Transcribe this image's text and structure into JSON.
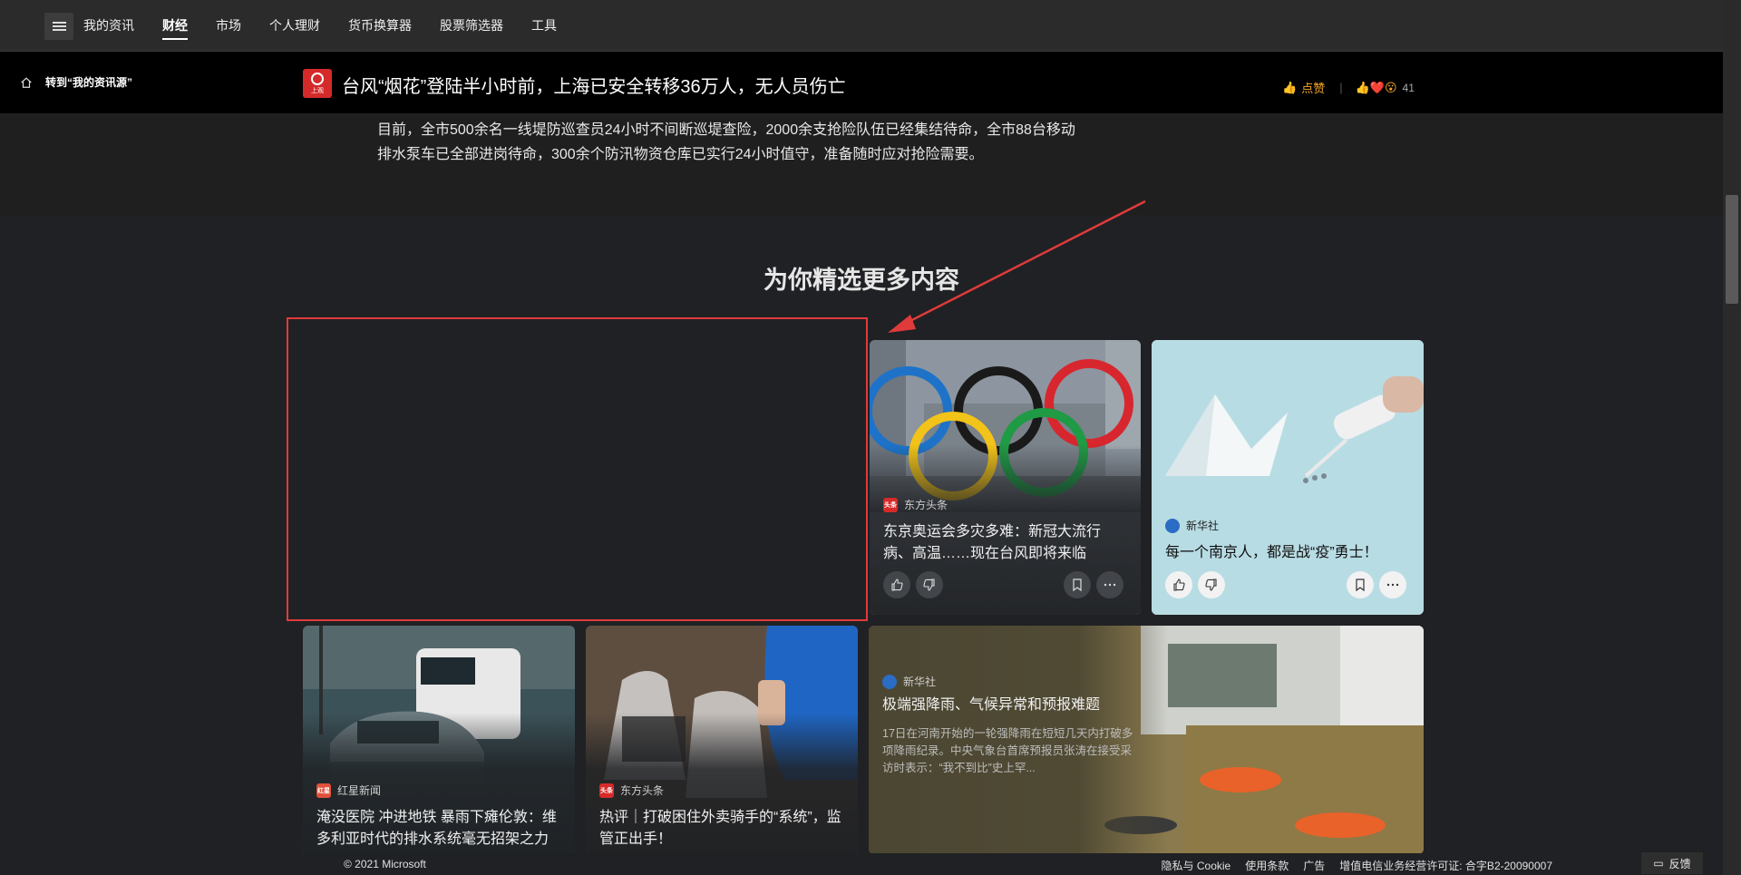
{
  "nav": {
    "items": [
      {
        "label": "我的资讯",
        "active": false
      },
      {
        "label": "财经",
        "active": true
      },
      {
        "label": "市场",
        "active": false
      },
      {
        "label": "个人理财",
        "active": false
      },
      {
        "label": "货币换算器",
        "active": false
      },
      {
        "label": "股票筛选器",
        "active": false
      },
      {
        "label": "工具",
        "active": false
      }
    ]
  },
  "article_header": {
    "back_label": "转到“我的资讯源”",
    "publisher_logo_text": "上观",
    "title": "台风“烟花”登陆半小时前，上海已安全转移36万人，无人员伤亡",
    "like_label": "点赞",
    "reaction_count": "41"
  },
  "article_body": {
    "paragraph": "目前，全市500余名一线堤防巡查员24小时不间断巡堤查险，2000余支抢险队伍已经集结待命，全市88台移动排水泵车已全部进岗待命，300余个防汛物资仓库已实行24小时值守，准备随时应对抢险需要。"
  },
  "section": {
    "title": "为你精选更多内容"
  },
  "cards": [
    {
      "source": "东方头条",
      "source_logo": "头条",
      "title": "东京奥运会多灾多难：新冠大流行病、高温……现在台风即将来临",
      "image": "olympic-rings"
    },
    {
      "source": "新华社",
      "title": "每一个南京人，都是战“疫”勇士！",
      "image": "medical-swab"
    },
    {
      "source": "红星新闻",
      "source_logo": "红星",
      "title": "淹没医院 冲进地铁 暴雨下瘫伦敦：维多利亚时代的排水系统毫无招架之力",
      "image": "flooded-street"
    },
    {
      "source": "东方头条",
      "source_logo": "头条",
      "title": "热评｜打破困住外卖骑手的“系统”，监管正出手！",
      "image": "delivery-bags"
    },
    {
      "source": "新华社",
      "title": "极端强降雨、气候异常和预报难题",
      "desc": "17日在河南开始的一轮强降雨在短短几天内打破多项降雨纪录。中央气象台首席预报员张涛在接受采访时表示：“我不到比”史上罕...",
      "image": "flood-rescue"
    }
  ],
  "footer": {
    "copyright": "© 2021 Microsoft",
    "links": [
      "隐私与 Cookie",
      "使用条款",
      "广告",
      "增值电信业务经营许可证: 合字B2-20090007"
    ],
    "feedback": "反馈"
  },
  "colors": {
    "accent": "#f5a623",
    "progress": "#1e5aa8",
    "annotation": "#e03b3b",
    "background": "#202124"
  }
}
